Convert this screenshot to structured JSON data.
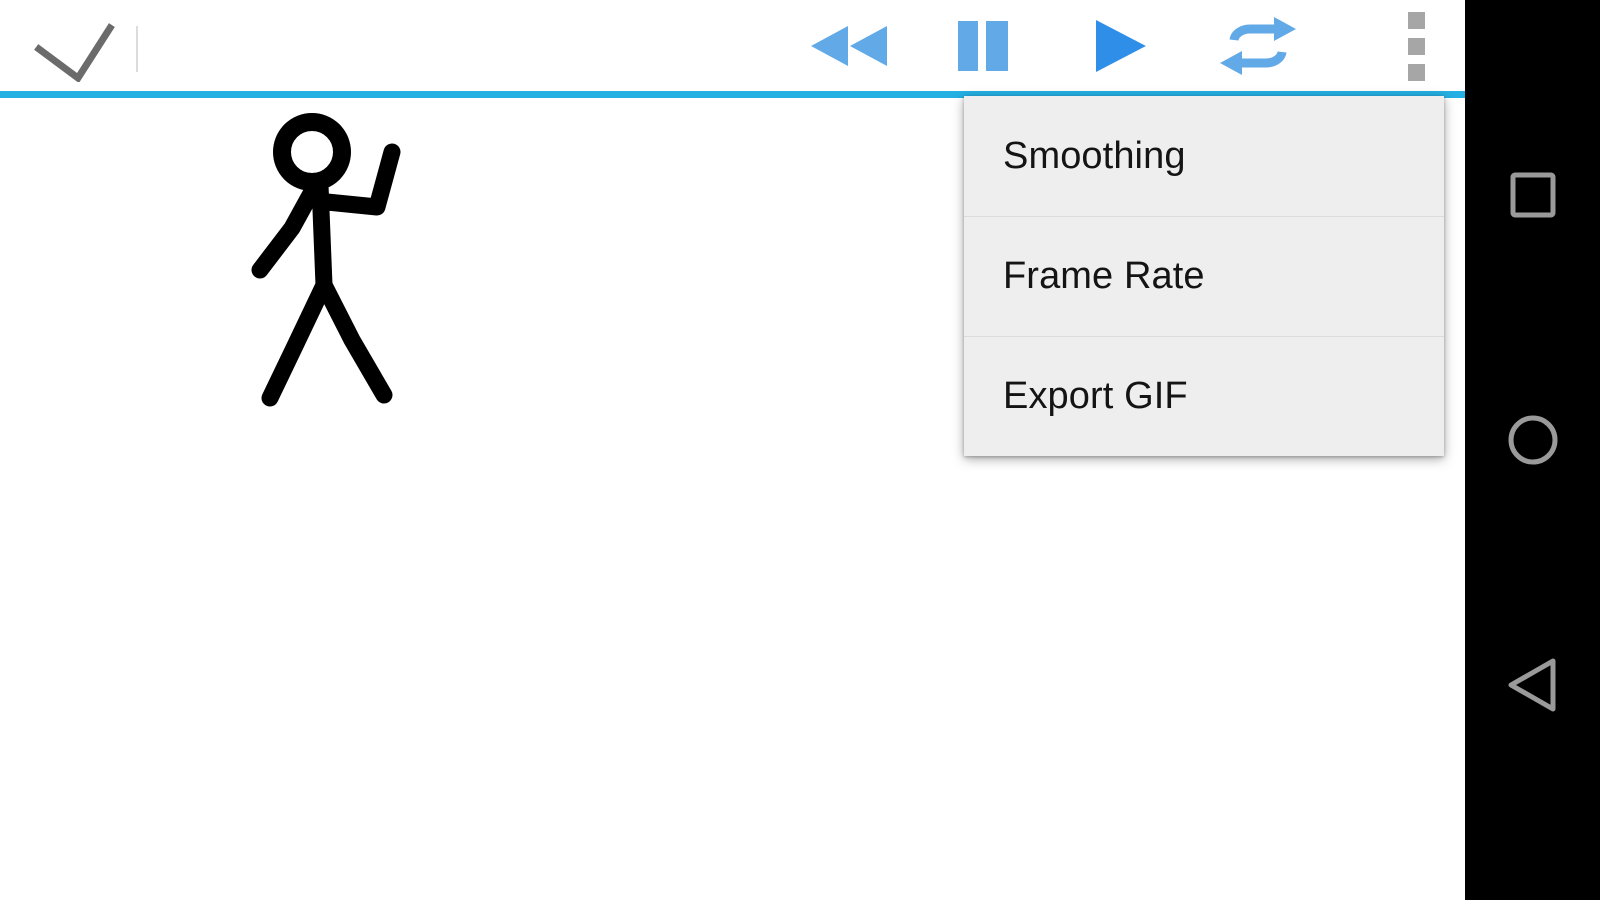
{
  "app": {
    "name": "stick-figure-animator",
    "accent_color": "#25b0e4",
    "canvas_background": "#ffffff"
  },
  "toolbar": {
    "confirm": {
      "icon": "check-icon",
      "label": "Done",
      "color": "#6b6b6b"
    },
    "divider": true,
    "controls": [
      {
        "name": "rewind-button",
        "icon": "rewind-icon",
        "label": "Rewind",
        "color": "#62a9e8",
        "state": "enabled"
      },
      {
        "name": "pause-button",
        "icon": "pause-icon",
        "label": "Pause",
        "color": "#62a9e8",
        "state": "enabled"
      },
      {
        "name": "play-button",
        "icon": "play-icon",
        "label": "Play",
        "color": "#62a9e8",
        "state": "enabled"
      },
      {
        "name": "loop-button",
        "icon": "loop-icon",
        "label": "Loop",
        "color": "#62a9e8",
        "state": "enabled"
      }
    ],
    "overflow": {
      "icon": "overflow-menu-icon",
      "label": "More options",
      "color": "#a6a6a6",
      "expanded": true
    }
  },
  "overflow_menu": {
    "visible": true,
    "background": "#eeeeee",
    "items": [
      {
        "label": "Smoothing"
      },
      {
        "label": "Frame Rate"
      },
      {
        "label": "Export GIF"
      }
    ]
  },
  "canvas": {
    "drawing_name": "stick-figure",
    "stroke_color": "#000000",
    "description": "Stick figure with raised right arm"
  },
  "nav_bar": {
    "background": "#000000",
    "icon_color": "#9a9a9a",
    "buttons": [
      {
        "name": "nav-recents",
        "icon": "square-icon",
        "label": "Overview"
      },
      {
        "name": "nav-home",
        "icon": "circle-icon",
        "label": "Home"
      },
      {
        "name": "nav-back",
        "icon": "triangle-left-icon",
        "label": "Back"
      }
    ]
  }
}
